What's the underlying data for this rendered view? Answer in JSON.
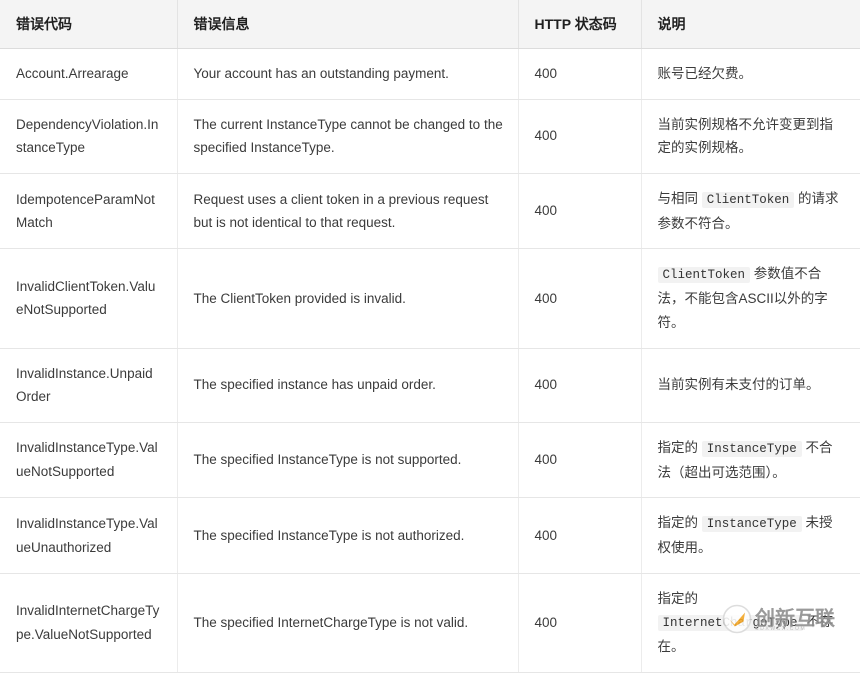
{
  "table": {
    "headers": [
      {
        "label": "错误代码",
        "key": "code"
      },
      {
        "label": "错误信息",
        "key": "message"
      },
      {
        "label": "HTTP 状态码",
        "key": "status"
      },
      {
        "label": "说明",
        "key": "description"
      }
    ],
    "rows": [
      {
        "code": "Account.Arrearage",
        "message": "Your account has an outstanding payment.",
        "status": "400",
        "description_parts": [
          {
            "type": "text",
            "value": "账号已经欠费。"
          }
        ]
      },
      {
        "code": "DependencyViolation.InstanceType",
        "message": "The current InstanceType cannot be changed to the specified InstanceType.",
        "status": "400",
        "description_parts": [
          {
            "type": "text",
            "value": "当前实例规格不允许变更到指定的实例规格。"
          }
        ]
      },
      {
        "code": "IdempotenceParamNotMatch",
        "message": "Request uses a client token in a previous request but is not identical to that request.",
        "status": "400",
        "description_parts": [
          {
            "type": "text",
            "value": "与相同 "
          },
          {
            "type": "code",
            "value": "ClientToken"
          },
          {
            "type": "text",
            "value": " 的请求参数不符合。"
          }
        ]
      },
      {
        "code": "InvalidClientToken.ValueNotSupported",
        "message": "The ClientToken provided is invalid.",
        "status": "400",
        "description_parts": [
          {
            "type": "code",
            "value": "ClientToken"
          },
          {
            "type": "text",
            "value": " 参数值不合法，不能包含ASCII以外的字符。"
          }
        ]
      },
      {
        "code": "InvalidInstance.UnpaidOrder",
        "message": "The specified instance has unpaid order.",
        "status": "400",
        "description_parts": [
          {
            "type": "text",
            "value": "当前实例有未支付的订单。"
          }
        ]
      },
      {
        "code": "InvalidInstanceType.ValueNotSupported",
        "message": "The specified InstanceType is not supported.",
        "status": "400",
        "description_parts": [
          {
            "type": "text",
            "value": "指定的 "
          },
          {
            "type": "code",
            "value": "InstanceType"
          },
          {
            "type": "text",
            "value": " 不合法（超出可选范围）。"
          }
        ]
      },
      {
        "code": "InvalidInstanceType.ValueUnauthorized",
        "message": "The specified InstanceType is not authorized.",
        "status": "400",
        "description_parts": [
          {
            "type": "text",
            "value": "指定的 "
          },
          {
            "type": "code",
            "value": "InstanceType"
          },
          {
            "type": "text",
            "value": " 未授权使用。"
          }
        ]
      },
      {
        "code": "InvalidInternetChargeType.ValueNotSupported",
        "message": "The specified InternetChargeType is not valid.",
        "status": "400",
        "description_parts": [
          {
            "type": "text",
            "value": "指定的 "
          },
          {
            "type": "code",
            "value": "InternetChargeType"
          },
          {
            "type": "text",
            "value": " 不存在。"
          }
        ]
      }
    ]
  },
  "watermark": {
    "text": "创新互联",
    "subtext": "CDXWCX.COM",
    "logo_color": "#f5a623",
    "text_color": "#8d8d8d"
  },
  "colors": {
    "header_bg": "#f4f4f4",
    "border": "#e6e6e6",
    "text": "#3b3b3b",
    "code_bg": "#f2f2f2"
  }
}
